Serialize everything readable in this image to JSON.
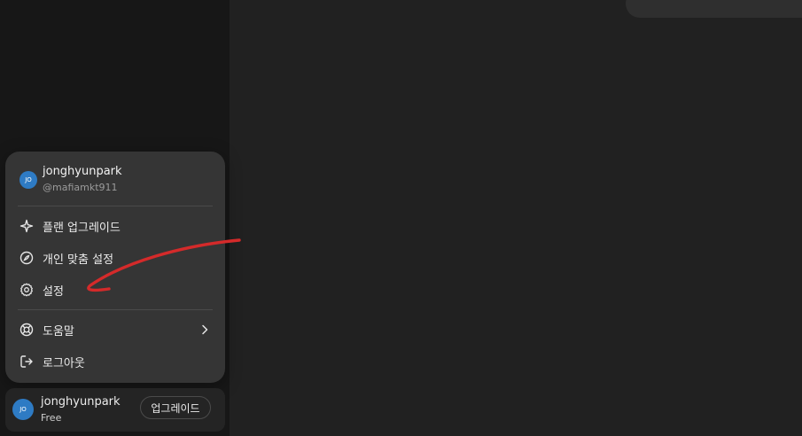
{
  "menu": {
    "user": {
      "avatar_initials": "JO",
      "name": "jonghyunpark",
      "handle": "@mafiamkt911"
    },
    "items": [
      {
        "label": "플랜 업그레이드",
        "icon": "sparkle-icon"
      },
      {
        "label": "개인 맞춤 설정",
        "icon": "personalize-icon"
      },
      {
        "label": "설정",
        "icon": "gear-icon"
      },
      {
        "label": "도움말",
        "icon": "lifebuoy-icon",
        "has_submenu": true
      },
      {
        "label": "로그아웃",
        "icon": "logout-icon"
      }
    ]
  },
  "footer": {
    "avatar_initials": "JO",
    "name": "jonghyunpark",
    "plan": "Free",
    "upgrade_label": "업그레이드"
  },
  "colors": {
    "sidebar_bg": "#171717",
    "main_bg": "#212121",
    "menu_bg": "#353535",
    "avatar_bg": "#2e7bc4",
    "annotation_red": "#d42a2a"
  }
}
